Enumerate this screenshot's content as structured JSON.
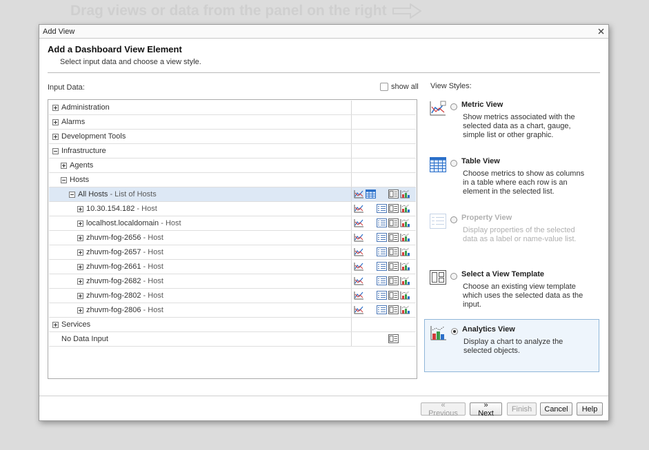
{
  "backdrop": {
    "hint": "Drag views or data from the panel on the right"
  },
  "dialog": {
    "title": "Add View",
    "heading": "Add a Dashboard View Element",
    "subheading": "Select input data and choose a view style.",
    "input_label": "Input Data:",
    "show_all_label": "show all",
    "styles_label": "View Styles:"
  },
  "tree": [
    {
      "label": "Administration",
      "type": "",
      "toggle": "plus",
      "indent": 0,
      "selected": false,
      "icons": []
    },
    {
      "label": "Alarms",
      "type": "",
      "toggle": "plus",
      "indent": 0,
      "selected": false,
      "icons": []
    },
    {
      "label": "Development Tools",
      "type": "",
      "toggle": "plus",
      "indent": 0,
      "selected": false,
      "icons": []
    },
    {
      "label": "Infrastructure",
      "type": "",
      "toggle": "minus",
      "indent": 0,
      "selected": false,
      "icons": []
    },
    {
      "label": "Agents",
      "type": "",
      "toggle": "plus",
      "indent": 1,
      "selected": false,
      "icons": []
    },
    {
      "label": "Hosts",
      "type": "",
      "toggle": "minus",
      "indent": 1,
      "selected": false,
      "icons": []
    },
    {
      "label": "All Hosts",
      "type": " - List of Hosts",
      "toggle": "minus",
      "indent": 2,
      "selected": true,
      "icons": [
        "metric-view",
        "table-view",
        "template-view",
        "analytics-view"
      ]
    },
    {
      "label": "10.30.154.182",
      "type": " - Host",
      "toggle": "plus",
      "indent": 3,
      "selected": false,
      "icons": [
        "metric-view",
        "property-view",
        "template-view",
        "analytics-view"
      ]
    },
    {
      "label": "localhost.localdomain",
      "type": " - Host",
      "toggle": "plus",
      "indent": 3,
      "selected": false,
      "icons": [
        "metric-view",
        "property-view",
        "template-view",
        "analytics-view"
      ]
    },
    {
      "label": "zhuvm-fog-2656",
      "type": " - Host",
      "toggle": "plus",
      "indent": 3,
      "selected": false,
      "icons": [
        "metric-view",
        "property-view",
        "template-view",
        "analytics-view"
      ]
    },
    {
      "label": "zhuvm-fog-2657",
      "type": " - Host",
      "toggle": "plus",
      "indent": 3,
      "selected": false,
      "icons": [
        "metric-view",
        "property-view",
        "template-view",
        "analytics-view"
      ]
    },
    {
      "label": "zhuvm-fog-2661",
      "type": " - Host",
      "toggle": "plus",
      "indent": 3,
      "selected": false,
      "icons": [
        "metric-view",
        "property-view",
        "template-view",
        "analytics-view"
      ]
    },
    {
      "label": "zhuvm-fog-2682",
      "type": " - Host",
      "toggle": "plus",
      "indent": 3,
      "selected": false,
      "icons": [
        "metric-view",
        "property-view",
        "template-view",
        "analytics-view"
      ]
    },
    {
      "label": "zhuvm-fog-2802",
      "type": " - Host",
      "toggle": "plus",
      "indent": 3,
      "selected": false,
      "icons": [
        "metric-view",
        "property-view",
        "template-view",
        "analytics-view"
      ]
    },
    {
      "label": "zhuvm-fog-2806",
      "type": " - Host",
      "toggle": "plus",
      "indent": 3,
      "selected": false,
      "icons": [
        "metric-view",
        "property-view",
        "template-view",
        "analytics-view"
      ]
    },
    {
      "label": "Services",
      "type": "",
      "toggle": "plus",
      "indent": 0,
      "selected": false,
      "icons": []
    },
    {
      "label": "No Data Input",
      "type": "",
      "toggle": "none",
      "indent": 0,
      "selected": false,
      "icons": [
        "template-view"
      ]
    }
  ],
  "view_styles": [
    {
      "key": "metric",
      "name": "Metric View",
      "description": "Show metrics associated with the selected data as a chart, gauge, simple list or other graphic.",
      "selected": false,
      "disabled": false,
      "icon": "metric-view-icon"
    },
    {
      "key": "table",
      "name": "Table View",
      "description": "Choose metrics to show as columns in a table where each row is an element in the selected list.",
      "selected": false,
      "disabled": false,
      "icon": "table-view-icon"
    },
    {
      "key": "property",
      "name": "Property View",
      "description": "Display properties of the selected data as a label or name-value list.",
      "selected": false,
      "disabled": true,
      "icon": "property-view-icon"
    },
    {
      "key": "template",
      "name": "Select a View Template",
      "description": "Choose an existing view template which uses the selected data as the input.",
      "selected": false,
      "disabled": false,
      "icon": "view-template-icon"
    },
    {
      "key": "analytics",
      "name": "Analytics View",
      "description": "Display a chart to analyze the selected objects.",
      "selected": true,
      "disabled": false,
      "icon": "analytics-view-icon"
    }
  ],
  "buttons": {
    "previous": "« Previous",
    "next": "» Next",
    "finish": "Finish",
    "cancel": "Cancel",
    "help": "Help"
  },
  "colors": {
    "selection": "#dde8f5",
    "accent_border": "#8fb6d9",
    "chart_blue": "#2a6fc9",
    "chart_red": "#d23b3b"
  }
}
